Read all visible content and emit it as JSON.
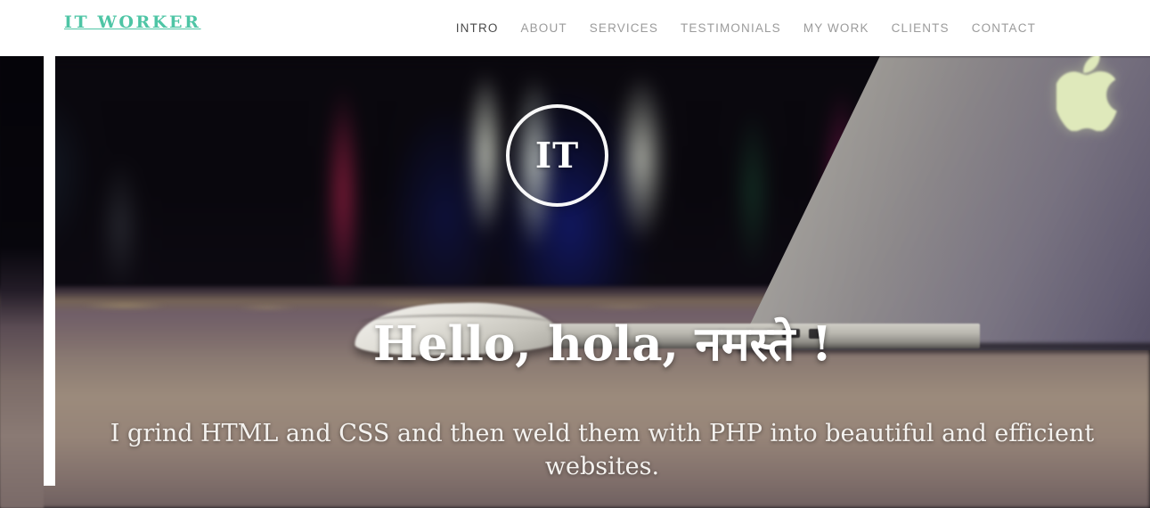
{
  "header": {
    "brand": "IT WORKER",
    "nav": [
      {
        "label": "INTRO",
        "active": true
      },
      {
        "label": "ABOUT",
        "active": false
      },
      {
        "label": "SERVICES",
        "active": false
      },
      {
        "label": "TESTIMONIALS",
        "active": false
      },
      {
        "label": "MY WORK",
        "active": false
      },
      {
        "label": "CLIENTS",
        "active": false
      },
      {
        "label": "CONTACT",
        "active": false
      }
    ]
  },
  "hero": {
    "badge_text": "IT",
    "title": "Hello, hola, नमस्ते !",
    "subtitle": "I grind HTML and CSS and then weld them with PHP into beautiful and efficient websites.",
    "background_description": "Blurred photo of a desk with an Apple Magic Mouse and a MacBook in front of a bookshelf"
  },
  "colors": {
    "brand_accent": "#4ec5a5",
    "nav_inactive": "#9b9b9b",
    "nav_active": "#4a4a4a",
    "header_background": "#ffffff",
    "hero_text": "#ffffff",
    "accent_rule": "#ffffff"
  }
}
